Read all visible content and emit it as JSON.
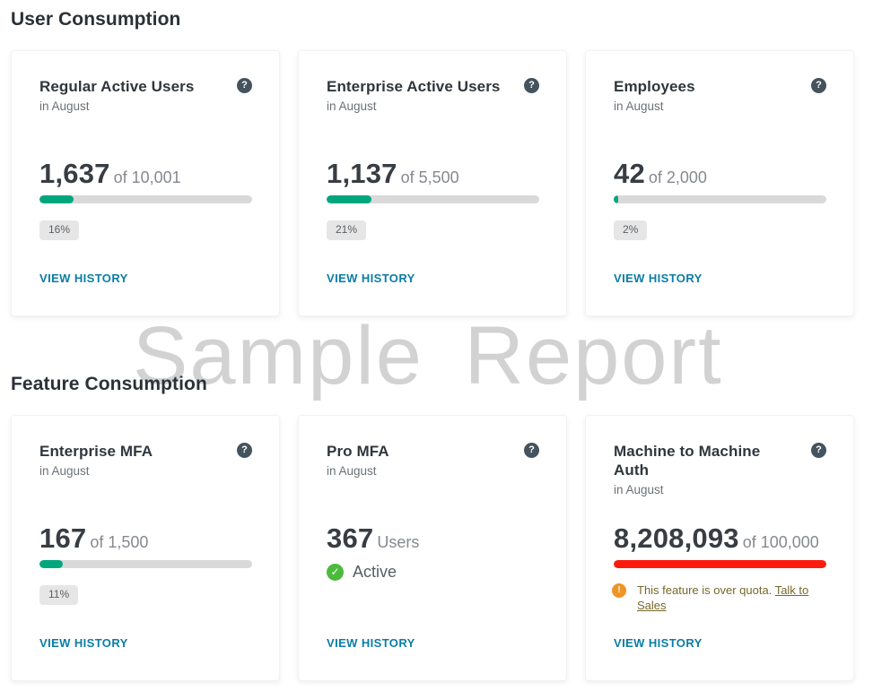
{
  "watermark": "Sample Report",
  "colors": {
    "progress_green": "#00a77d",
    "progress_red": "#fb1c0e",
    "link_blue": "#0b7da6",
    "active_green": "#4cba3c",
    "warning_orange": "#ef9426",
    "warning_text_olive": "#76682a",
    "watermark_gray": "#d2d2d2",
    "help_icon_slate": "#44535e"
  },
  "user_consumption": {
    "heading": "User Consumption",
    "cards": [
      {
        "title": "Regular Active Users",
        "period": "in August",
        "value": "1,637",
        "quota": "of 10,001",
        "percent": 16,
        "percent_label": "16%",
        "help_icon": "?",
        "link": "VIEW HISTORY"
      },
      {
        "title": "Enterprise Active Users",
        "period": "in August",
        "value": "1,137",
        "quota": "of 5,500",
        "percent": 21,
        "percent_label": "21%",
        "help_icon": "?",
        "link": "VIEW HISTORY"
      },
      {
        "title": "Employees",
        "period": "in August",
        "value": "42",
        "quota": "of 2,000",
        "percent": 2,
        "percent_label": "2%",
        "help_icon": "?",
        "link": "VIEW HISTORY"
      }
    ]
  },
  "feature_consumption": {
    "heading": "Feature Consumption",
    "cards": [
      {
        "title": "Enterprise MFA",
        "period": "in August",
        "value": "167",
        "quota": "of 1,500",
        "percent": 11,
        "percent_label": "11%",
        "help_icon": "?",
        "link": "VIEW HISTORY"
      },
      {
        "title": "Pro MFA",
        "period": "in August",
        "value": "367",
        "unit": "Users",
        "status": "Active",
        "status_icon": "✓",
        "help_icon": "?",
        "link": "VIEW HISTORY"
      },
      {
        "title": "Machine to Machine Auth",
        "period": "in August",
        "value": "8,208,093",
        "quota": "of 100,000",
        "percent": 100,
        "warning_icon": "!",
        "warning_message": "This feature is over quota. ",
        "warning_link": "Talk to Sales",
        "help_icon": "?",
        "link": "VIEW HISTORY"
      }
    ]
  }
}
